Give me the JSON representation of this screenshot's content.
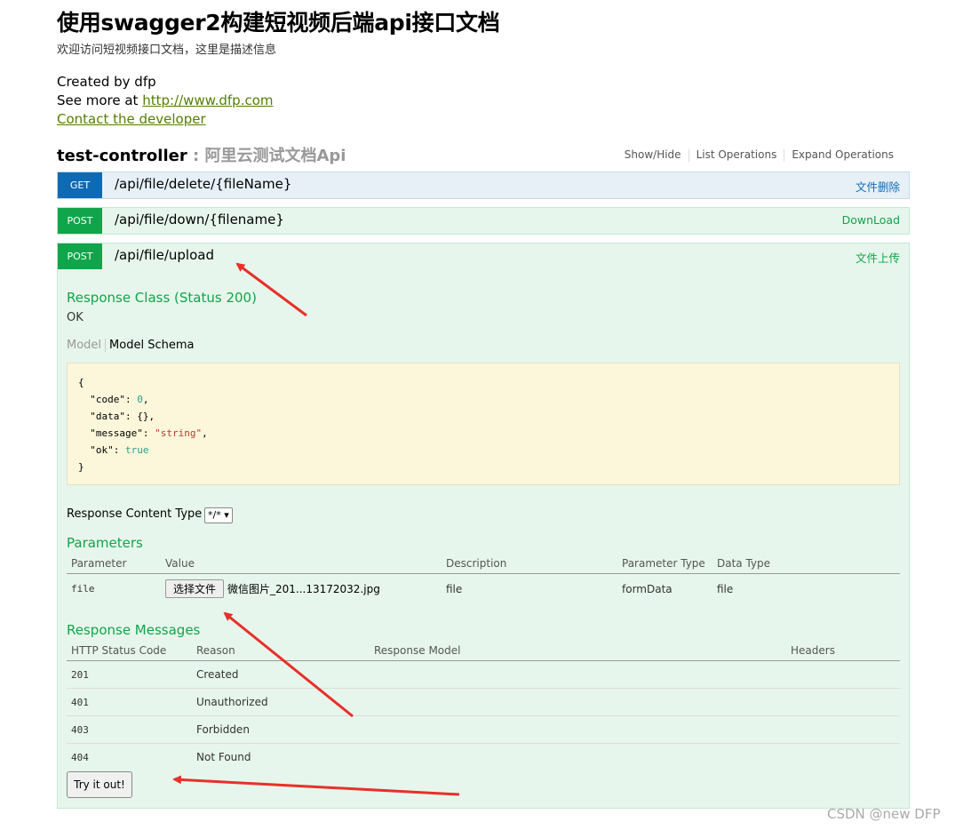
{
  "header": {
    "title": "使用swagger2构建短视频后端api接口文档",
    "description": "欢迎访问短视频接口文档，这里是描述信息",
    "created_by": "Created by dfp",
    "see_more_prefix": "See more at ",
    "see_more_link": "http://www.dfp.com",
    "contact": "Contact the developer"
  },
  "resource": {
    "name": "test-controller",
    "separator": " : ",
    "description": "阿里云测试文档Api",
    "options": [
      "Show/Hide",
      "List Operations",
      "Expand Operations"
    ]
  },
  "operations": [
    {
      "method": "GET",
      "path": "/api/file/delete/{fileName}",
      "summary": "文件删除"
    },
    {
      "method": "POST",
      "path": "/api/file/down/{filename}",
      "summary": "DownLoad"
    },
    {
      "method": "POST",
      "path": "/api/file/upload",
      "summary": "文件上传"
    }
  ],
  "expanded": {
    "response_class_title": "Response Class (Status 200)",
    "response_class_value": "OK",
    "model_tab": "Model",
    "model_schema_tab": "Model Schema",
    "schema": {
      "open": "{",
      "code_key": "  \"code\": ",
      "code_val": "0",
      "data_key": "  \"data\": ",
      "data_val": "{},",
      "message_key": "  \"message\": ",
      "message_val": "\"string\"",
      "ok_key": "  \"ok\": ",
      "ok_val": "true",
      "close": "}",
      "comma": ","
    },
    "response_content_type_label": "Response Content Type",
    "response_content_type_value": "*/* ▾",
    "parameters_title": "Parameters",
    "param_headers": [
      "Parameter",
      "Value",
      "Description",
      "Parameter Type",
      "Data Type"
    ],
    "params": [
      {
        "name": "file",
        "button": "选择文件",
        "filename": "微信图片_201...13172032.jpg",
        "description": "file",
        "param_type": "formData",
        "data_type": "file"
      }
    ],
    "response_messages_title": "Response Messages",
    "msg_headers": [
      "HTTP Status Code",
      "Reason",
      "Response Model",
      "Headers"
    ],
    "messages": [
      {
        "code": "201",
        "reason": "Created"
      },
      {
        "code": "401",
        "reason": "Unauthorized"
      },
      {
        "code": "403",
        "reason": "Forbidden"
      },
      {
        "code": "404",
        "reason": "Not Found"
      }
    ],
    "try_button": "Try it out!"
  },
  "watermark": "CSDN @new DFP",
  "colors": {
    "get": "#0f6ab4",
    "post": "#10a54a",
    "link": "#547f00",
    "arrow": "#e8302a",
    "schema_bg": "#fcf6db"
  }
}
